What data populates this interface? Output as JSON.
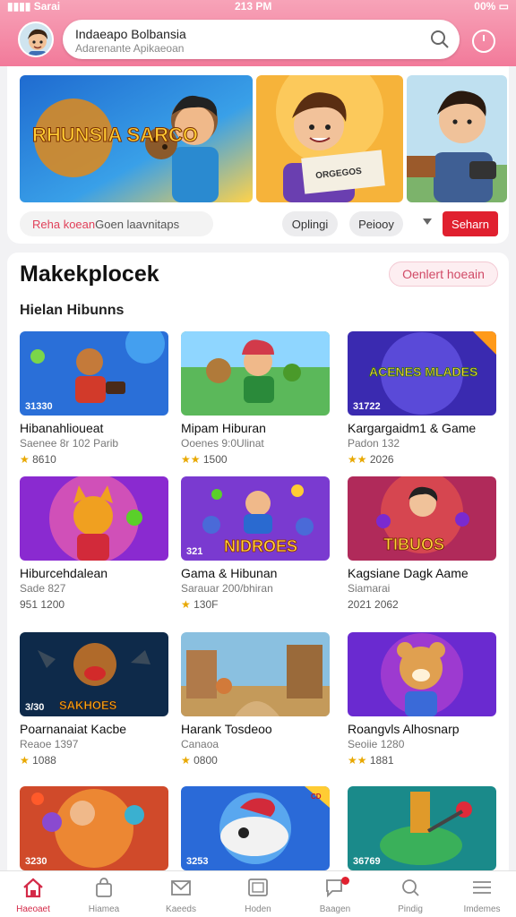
{
  "status": {
    "carrier": "Sarai",
    "time": "213 PM",
    "battery": "00%"
  },
  "header": {
    "search_title": "Indaeapo Bolbansia",
    "search_subtitle": "Adarenante Apikaeoan",
    "icons": [
      "avatar",
      "search-icon",
      "power-icon"
    ]
  },
  "featured": {
    "promo_highlight": "Reha koean",
    "promo_text": " Goen laavnitaps",
    "pill_2": "Oplingi",
    "pill_3": "Peiooy",
    "action": "Seharn",
    "banner_1_text": "RHUNSIA SARCO",
    "banner_2_text": "ORGEGOS"
  },
  "section": {
    "title": "Makekplocek",
    "action": "Oenlert hoeain",
    "subtitle": "Hielan Hibunns"
  },
  "games": [
    {
      "badge": "31330",
      "name": "Hibanahlioueat",
      "meta": "Saenee 8r 102 Parib",
      "rating": "8610",
      "stars": 1
    },
    {
      "badge": "",
      "name": "Mipam Hiburan",
      "meta": "Ooenes 9:0Ulinat",
      "rating": "1500",
      "stars": 2
    },
    {
      "badge": "31722",
      "name": "Kargargaidm1 & Game",
      "meta": "Padon 132",
      "rating": "2026",
      "stars": 2,
      "thumb_text": "ACENES MLADES"
    },
    {
      "badge": "",
      "name": "Hiburcehdalean",
      "meta": "Sade 827",
      "rating": "951 1200",
      "stars": 0
    },
    {
      "badge": "321",
      "name": "Gama & Hibunan",
      "meta": "Sarauar 200/bhiran",
      "rating": "130F",
      "stars": 1,
      "thumb_text": "NIDROES"
    },
    {
      "badge": "",
      "name": "Kagsiane Dagk Aame",
      "meta": "Siamarai",
      "rating": "2021 2062",
      "stars": 0,
      "thumb_text": "TIBUOS"
    },
    {
      "badge": "3/30",
      "name": "Poarnanaiat Kacbe",
      "meta": "Reaoe 1397",
      "rating": "1088",
      "stars": 1,
      "thumb_text": "SAKHOES"
    },
    {
      "badge": "",
      "name": "Harank Tosdeoo",
      "meta": "Canaoa",
      "rating": "0800",
      "stars": 1
    },
    {
      "badge": "",
      "name": "Roangvls Alhosnarp",
      "meta": "Seoiie 1280",
      "rating": "1881",
      "stars": 2
    },
    {
      "badge": "3230",
      "name": "",
      "meta": "",
      "rating": "",
      "stars": 0
    },
    {
      "badge": "3253",
      "name": "",
      "meta": "",
      "rating": "",
      "stars": 0,
      "thumb_text": "CD"
    },
    {
      "badge": "36769",
      "name": "",
      "meta": "",
      "rating": "",
      "stars": 0
    }
  ],
  "nav": [
    {
      "label": "Haeoaet",
      "icon": "home-icon",
      "active": true
    },
    {
      "label": "Hiamea",
      "icon": "bag-icon"
    },
    {
      "label": "Kaeeds",
      "icon": "mail-icon"
    },
    {
      "label": "Hoden",
      "icon": "photo-icon"
    },
    {
      "label": "Baagen",
      "icon": "chat-icon"
    },
    {
      "label": "Pindig",
      "icon": "search-icon"
    },
    {
      "label": "Imdemes",
      "icon": "menu-icon"
    }
  ],
  "colors": {
    "accent": "#e0202f",
    "header_top": "#f7a3b8",
    "header_bottom": "#f27a9a",
    "star": "#e8a800"
  }
}
